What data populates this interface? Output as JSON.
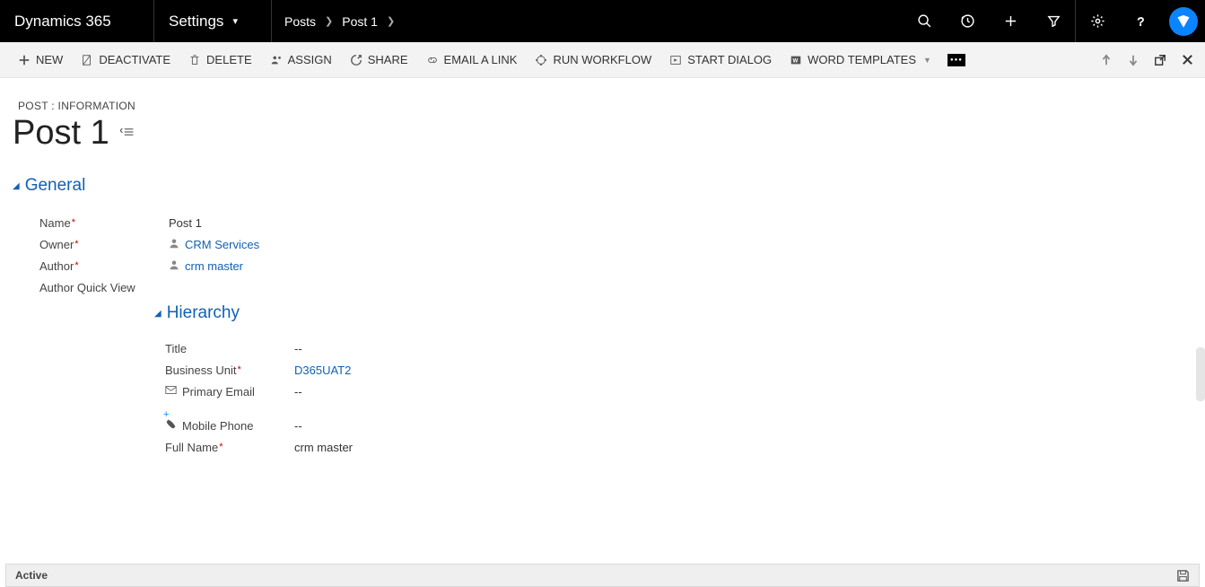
{
  "topbar": {
    "brand": "Dynamics 365",
    "area": "Settings",
    "crumbs": [
      "Posts",
      "Post 1"
    ]
  },
  "cmdbar": {
    "new": "NEW",
    "deactivate": "DEACTIVATE",
    "delete": "DELETE",
    "assign": "ASSIGN",
    "share": "SHARE",
    "emaillink": "EMAIL A LINK",
    "runworkflow": "RUN WORKFLOW",
    "startdialog": "START DIALOG",
    "wordtemplates": "WORD TEMPLATES"
  },
  "header": {
    "formtype": "POST : INFORMATION",
    "title": "Post 1"
  },
  "sections": {
    "general": "General",
    "hierarchy": "Hierarchy"
  },
  "general": {
    "name_label": "Name",
    "name_value": "Post 1",
    "owner_label": "Owner",
    "owner_value": "CRM Services",
    "author_label": "Author",
    "author_value": "crm master",
    "aqv_label": "Author Quick View"
  },
  "hierarchy": {
    "title_label": "Title",
    "title_value": "--",
    "bu_label": "Business Unit",
    "bu_value": "D365UAT2",
    "email_label": "Primary Email",
    "email_value": "--",
    "mobile_label": "Mobile Phone",
    "mobile_value": "--",
    "fullname_label": "Full Name",
    "fullname_value": "crm master"
  },
  "status": {
    "text": "Active"
  }
}
